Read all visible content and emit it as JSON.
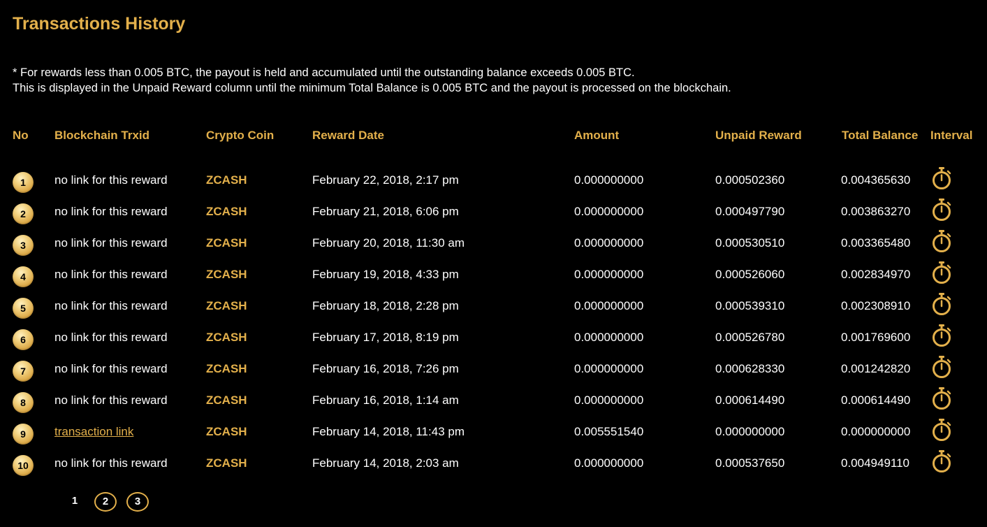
{
  "page": {
    "title": "Transactions History",
    "note_line1": "* For rewards less than 0.005 BTC, the payout is held and accumulated until the outstanding balance exceeds 0.005 BTC.",
    "note_line2": "This is displayed in the Unpaid Reward column until the minimum Total Balance is 0.005 BTC and the payout is processed on the blockchain."
  },
  "colors": {
    "accent": "#e3b04b",
    "background": "#000000",
    "text": "#ffffff"
  },
  "table": {
    "headers": {
      "no": "No",
      "txid": "Blockchain Trxid",
      "coin": "Crypto Coin",
      "date": "Reward Date",
      "amount": "Amount",
      "unpaid": "Unpaid Reward",
      "total": "Total Balance",
      "interval": "Interval"
    },
    "interval_icon": "stopwatch-icon",
    "rows": [
      {
        "no": "1",
        "txid": "no link for this reward",
        "is_link": false,
        "coin": "ZCASH",
        "date": "February 22, 2018, 2:17 pm",
        "amount": "0.000000000",
        "unpaid": "0.000502360",
        "total": "0.004365630"
      },
      {
        "no": "2",
        "txid": "no link for this reward",
        "is_link": false,
        "coin": "ZCASH",
        "date": "February 21, 2018, 6:06 pm",
        "amount": "0.000000000",
        "unpaid": "0.000497790",
        "total": "0.003863270"
      },
      {
        "no": "3",
        "txid": "no link for this reward",
        "is_link": false,
        "coin": "ZCASH",
        "date": "February 20, 2018, 11:30 am",
        "amount": "0.000000000",
        "unpaid": "0.000530510",
        "total": "0.003365480"
      },
      {
        "no": "4",
        "txid": "no link for this reward",
        "is_link": false,
        "coin": "ZCASH",
        "date": "February 19, 2018, 4:33 pm",
        "amount": "0.000000000",
        "unpaid": "0.000526060",
        "total": "0.002834970"
      },
      {
        "no": "5",
        "txid": "no link for this reward",
        "is_link": false,
        "coin": "ZCASH",
        "date": "February 18, 2018, 2:28 pm",
        "amount": "0.000000000",
        "unpaid": "0.000539310",
        "total": "0.002308910"
      },
      {
        "no": "6",
        "txid": "no link for this reward",
        "is_link": false,
        "coin": "ZCASH",
        "date": "February 17, 2018, 8:19 pm",
        "amount": "0.000000000",
        "unpaid": "0.000526780",
        "total": "0.001769600"
      },
      {
        "no": "7",
        "txid": "no link for this reward",
        "is_link": false,
        "coin": "ZCASH",
        "date": "February 16, 2018, 7:26 pm",
        "amount": "0.000000000",
        "unpaid": "0.000628330",
        "total": "0.001242820"
      },
      {
        "no": "8",
        "txid": "no link for this reward",
        "is_link": false,
        "coin": "ZCASH",
        "date": "February 16, 2018, 1:14 am",
        "amount": "0.000000000",
        "unpaid": "0.000614490",
        "total": "0.000614490"
      },
      {
        "no": "9",
        "txid": "transaction link",
        "is_link": true,
        "coin": "ZCASH",
        "date": "February 14, 2018, 11:43 pm",
        "amount": "0.005551540",
        "unpaid": "0.000000000",
        "total": "0.000000000"
      },
      {
        "no": "10",
        "txid": "no link for this reward",
        "is_link": false,
        "coin": "ZCASH",
        "date": "February 14, 2018, 2:03 am",
        "amount": "0.000000000",
        "unpaid": "0.000537650",
        "total": "0.004949110"
      }
    ]
  },
  "pagination": {
    "current": 1,
    "pages": [
      "1",
      "2",
      "3"
    ]
  }
}
